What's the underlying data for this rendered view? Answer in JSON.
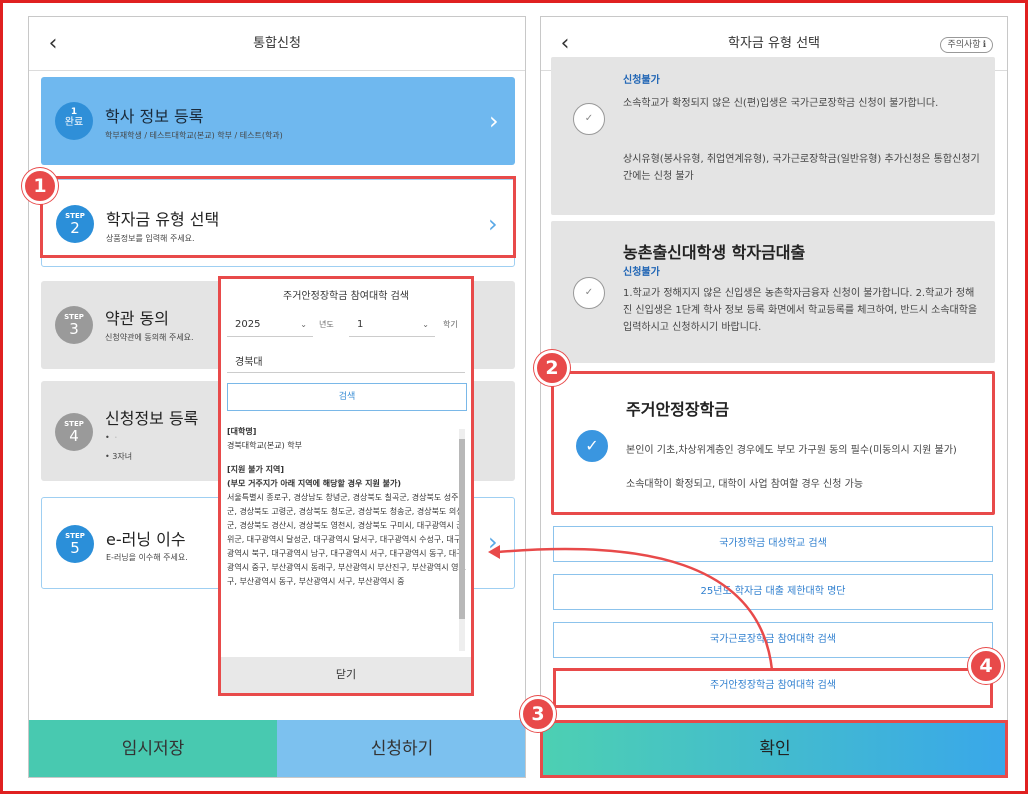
{
  "left": {
    "header_title": "통합신청",
    "steps": [
      {
        "badge_top": "1",
        "badge_bottom": "완료",
        "title": "학사 정보 등록",
        "sub": "학부재학생 / 테스트대학교(본교) 학부 / 테스트(학과)"
      },
      {
        "badge_top": "STEP",
        "badge_bottom": "2",
        "title": "학자금 유형 선택",
        "sub": "상품정보를 입력해 주세요."
      },
      {
        "badge_top": "STEP",
        "badge_bottom": "3",
        "title": "약관 동의",
        "sub": "신청약관에 동의해 주세요."
      },
      {
        "badge_top": "STEP",
        "badge_bottom": "4",
        "title": "신청정보 등록",
        "sub": "• ᆞ",
        "sub2": "• 3자녀"
      },
      {
        "badge_top": "STEP",
        "badge_bottom": "5",
        "title": "e-러닝 이수",
        "sub": "E-러닝을 이수해 주세요."
      }
    ],
    "temp_save": "임시저장",
    "apply": "신청하기"
  },
  "modal": {
    "title": "주거안정장학금 참여대학 검색",
    "year_value": "2025",
    "year_label": "년도",
    "term_value": "1",
    "term_label": "학기",
    "query": "경북대",
    "search_label": "검색",
    "univ_header": "[대학명]",
    "univ_value": "경북대학교(본교) 학부",
    "region_header": "[지원 불가 지역]",
    "region_note": "(부모 거주지가 아래 지역에 해당할 경우 지원 불가)",
    "regions": "서울특별시 종로구, 경상남도 창녕군, 경상북도 칠곡군, 경상북도 성주군, 경상북도 고령군, 경상북도 청도군, 경상북도 청송군, 경상북도 의성군, 경상북도 경산시, 경상북도 영천시, 경상북도 구미시, 대구광역시 군위군, 대구광역시 달성군, 대구광역시 달서구, 대구광역시 수성구, 대구광역시 북구, 대구광역시 남구, 대구광역시 서구, 대구광역시 동구, 대구광역시 중구, 부산광역시 동래구, 부산광역시 부산진구, 부산광역시 영도구, 부산광역시 동구, 부산광역시 서구, 부산광역시 중",
    "close_label": "닫기"
  },
  "right": {
    "header_title": "학자금 유형 선택",
    "notice_label": "주의사항",
    "options": [
      {
        "tag": "신청불가",
        "desc1": "소속학교가 확정되지 않은 신(편)입생은 국가근로장학금 신청이 불가합니다.",
        "desc2": "상시유형(봉사유형, 취업연계유형), 국가근로장학금(일반유형) 추가신청은 통합신청기간에는 신청 불가"
      },
      {
        "title": "농촌출신대학생 학자금대출",
        "tag": "신청불가",
        "desc": "1.학교가 정해지지 않은 신입생은 농촌학자금융자 신청이 불가합니다. 2.학교가 정해진 신입생은 1단계 학사 정보 등록 화면에서 학교등록를 체크하여, 반드시 소속대학을 입력하시고 신청하시기 바랍니다."
      },
      {
        "title": "주거안정장학금",
        "desc": "본인이 기초,차상위계층인 경우에도 부모 가구원 동의 필수(미동의시 지원 불가)",
        "desc2": "소속대학이 확정되고, 대학이 사업 참여할 경우 신청 가능"
      }
    ],
    "links": [
      "국가장학금 대상학교 검색",
      "25년도 학자금 대출 제한대학 명단",
      "국가근로장학금 참여대학 검색",
      "주거안정장학금 참여대학 검색"
    ],
    "confirm": "확인"
  },
  "annotations": [
    "1",
    "2",
    "3",
    "4"
  ],
  "colors": {
    "accent": "#3a96e0",
    "annotation": "#e84a4a",
    "done_card": "#6fb8ef"
  }
}
